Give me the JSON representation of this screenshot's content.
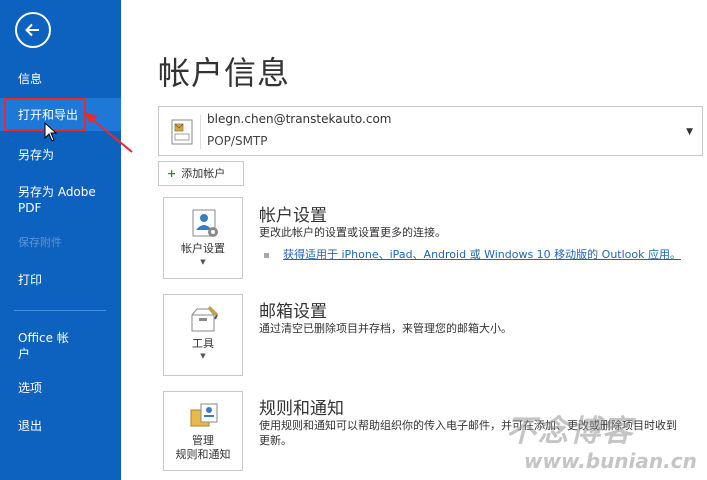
{
  "sidebar": {
    "items": [
      {
        "label": "信息"
      },
      {
        "label": "打开和导出"
      },
      {
        "label": "另存为"
      },
      {
        "label": "另存为 Adobe"
      },
      {
        "label": "PDF"
      },
      {
        "label": "保存附件"
      },
      {
        "label": "打印"
      },
      {
        "label": "Office 帐"
      },
      {
        "label": "户"
      },
      {
        "label": "选项"
      },
      {
        "label": "退出"
      }
    ]
  },
  "main": {
    "title": "帐户信息",
    "account": {
      "email": "blegn.chen@transtekauto.com",
      "type": "POP/SMTP"
    },
    "add_account_label": "添加帐户",
    "sections": {
      "account_settings": {
        "tile_label": "帐户设置",
        "title": "帐户设置",
        "description": "更改此帐户的设置或设置更多的连接。",
        "link": "获得适用于 iPhone、iPad、Android 或 Windows 10 移动版的 Outlook 应用。"
      },
      "mailbox_settings": {
        "tile_label": "工具",
        "title": "邮箱设置",
        "description": "通过清空已删除项目并存档，来管理您的邮箱大小。"
      },
      "rules": {
        "tile_label_1": "管理",
        "tile_label_2": "规则和通知",
        "title": "规则和通知",
        "description_1": "使用规则和通知可以帮助组织你的传入电子邮件，并可在添加、更改或删除项目时收到",
        "description_2": "更新。"
      }
    }
  },
  "watermark": {
    "text": "不念博客",
    "url": "www.bunian.cn"
  },
  "colors": {
    "sidebar_bg": "#0d62bf",
    "sidebar_active": "#1d78d8",
    "highlight": "#e8292e",
    "link": "#1f66b4"
  }
}
